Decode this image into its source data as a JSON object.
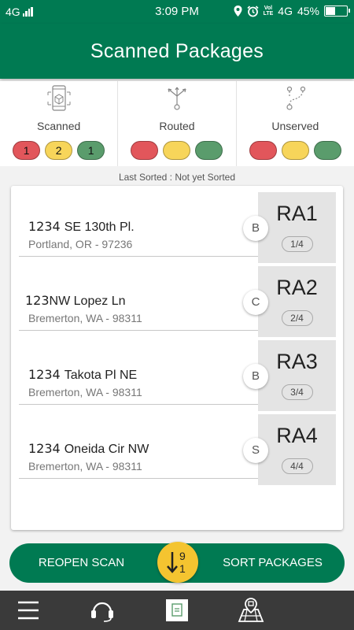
{
  "status_bar": {
    "network": "4G",
    "time": "3:09 PM",
    "volte_line1": "Vol",
    "volte_line2": "LTE",
    "network_right": "4G",
    "battery": "45%",
    "battery_level": 0.45
  },
  "header": {
    "title": "Scanned Packages"
  },
  "summary": [
    {
      "label": "Scanned",
      "icon": "phone-scan-icon",
      "counts": [
        "1",
        "2",
        "1"
      ]
    },
    {
      "label": "Routed",
      "icon": "route-split-icon",
      "counts": [
        "",
        "",
        ""
      ]
    },
    {
      "label": "Unserved",
      "icon": "path-pins-icon",
      "counts": [
        "",
        "",
        ""
      ]
    }
  ],
  "status_colors": {
    "red": "#e2565b",
    "yellow": "#f7d55a",
    "green": "#5a9c6c",
    "brand": "#007a52"
  },
  "last_sorted": "Last Sorted : Not yet Sorted",
  "packages": [
    {
      "number": "1234",
      "street": "SE 130th Pl.",
      "city": "Portland, OR - 97236",
      "lane": "B",
      "zone": "RA1",
      "position": "1/4"
    },
    {
      "number": "123",
      "street": "NW Lopez Ln",
      "city": "Bremerton, WA - 98311",
      "lane": "C",
      "zone": "RA2",
      "position": "2/4"
    },
    {
      "number": "1234",
      "street": "Takota Pl NE",
      "city": "Bremerton, WA - 98311",
      "lane": "B",
      "zone": "RA3",
      "position": "3/4"
    },
    {
      "number": "1234",
      "street": "Oneida Cir NW",
      "city": "Bremerton, WA - 98311",
      "lane": "S",
      "zone": "RA4",
      "position": "4/4"
    }
  ],
  "actions": {
    "reopen": "REOPEN SCAN",
    "sort": "SORT PACKAGES",
    "sort_icon_top": "9",
    "sort_icon_bottom": "1"
  },
  "nav": [
    "menu-icon",
    "headset-icon",
    "document-icon",
    "map-icon"
  ]
}
